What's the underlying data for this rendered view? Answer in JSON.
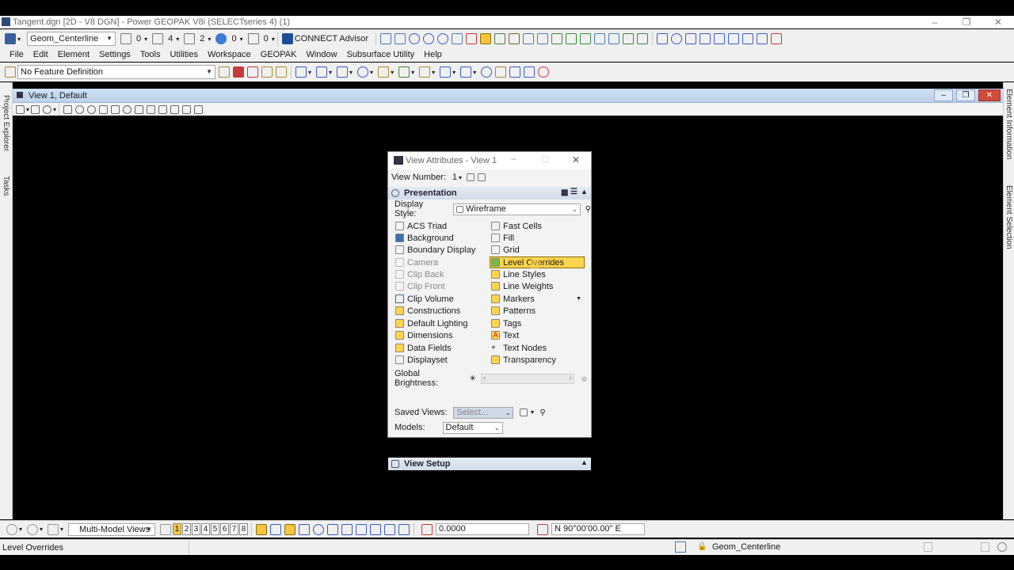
{
  "window": {
    "title": "Tangent.dgn [2D - V8 DGN] - Power GEOPAK V8i (SELECTseries 4) (1)"
  },
  "toolbar1": {
    "level_combo": "Geom_Centerline",
    "count_a": "0",
    "count_b": "4",
    "count_c": "2",
    "count_d": "0",
    "count_e": "0",
    "connect_advisor": "CONNECT Advisor"
  },
  "menu": [
    "File",
    "Edit",
    "Element",
    "Settings",
    "Tools",
    "Utilities",
    "Workspace",
    "GEOPAK",
    "Window",
    "Subsurface Utility",
    "Help"
  ],
  "toolbar2": {
    "feature_definition": "No Feature Definition"
  },
  "left_rail": {
    "project_explorer": "Project Explorer",
    "tasks": "Tasks"
  },
  "right_rail": {
    "element_information": "Element Information",
    "element_selection": "Element Selection"
  },
  "view": {
    "title": "View 1, Default"
  },
  "dialog": {
    "title": "View Attributes - View 1",
    "view_number_label": "View Number:",
    "view_number": "1",
    "presentation": "Presentation",
    "display_style_label": "Display Style:",
    "display_style": "Wireframe",
    "left_items": [
      {
        "label": "ACS Triad",
        "enabled": true
      },
      {
        "label": "Background",
        "enabled": true
      },
      {
        "label": "Boundary Display",
        "enabled": true
      },
      {
        "label": "Camera",
        "enabled": false
      },
      {
        "label": "Clip Back",
        "enabled": false
      },
      {
        "label": "Clip Front",
        "enabled": false
      },
      {
        "label": "Clip Volume",
        "enabled": true
      },
      {
        "label": "Constructions",
        "enabled": true
      },
      {
        "label": "Default Lighting",
        "enabled": true
      },
      {
        "label": "Dimensions",
        "enabled": true
      },
      {
        "label": "Data Fields",
        "enabled": true
      },
      {
        "label": "Displayset",
        "enabled": true
      }
    ],
    "right_items": [
      {
        "label": "Fast Cells",
        "enabled": true
      },
      {
        "label": "Fill",
        "enabled": true
      },
      {
        "label": "Grid",
        "enabled": true
      },
      {
        "label": "Level Overrides",
        "enabled": true,
        "highlighted": true
      },
      {
        "label": "Line Styles",
        "enabled": true
      },
      {
        "label": "Line Weights",
        "enabled": true
      },
      {
        "label": "Markers",
        "enabled": true
      },
      {
        "label": "Patterns",
        "enabled": true
      },
      {
        "label": "Tags",
        "enabled": true
      },
      {
        "label": "Text",
        "enabled": true
      },
      {
        "label": "Text Nodes",
        "enabled": true
      },
      {
        "label": "Transparency",
        "enabled": true
      }
    ],
    "global_brightness_label": "Global Brightness:",
    "view_setup": "View Setup",
    "saved_views_label": "Saved Views:",
    "saved_views_placeholder": "Select...",
    "models_label": "Models:",
    "models_value": "Default"
  },
  "bottom_toolbar": {
    "multi_model": "Multi-Model Views",
    "view_numbers": [
      "1",
      "2",
      "3",
      "4",
      "5",
      "6",
      "7",
      "8"
    ],
    "distance": "0.0000",
    "bearing": "N 90°00'00.00\" E"
  },
  "status": {
    "message": "Level Overrides",
    "active_level": "Geom_Centerline"
  },
  "colors": {
    "highlight": "#ffd54f",
    "view_title": "#c6d9ef",
    "canvas": "#000000"
  }
}
